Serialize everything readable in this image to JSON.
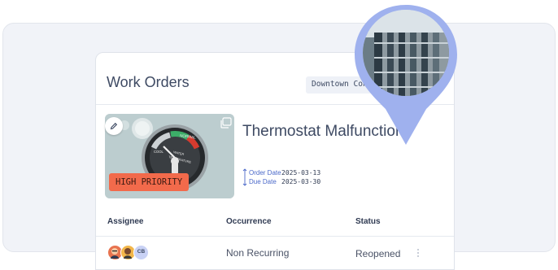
{
  "work_orders": {
    "title": "Work Orders",
    "contract_chip": "Downtown Contract",
    "item": {
      "title": "Thermostat Malfunction",
      "priority_badge": "HIGH PRIORITY",
      "order_date_label": "Order Date",
      "order_date": "2025-03-13",
      "due_date_label": "Due Date",
      "due_date": "2025-03-30"
    },
    "gauge": {
      "normal_label": "NORMAL",
      "cool_label": "COOL",
      "dial_label_line1": "WATER",
      "dial_label_line2": "TEMPERATURE"
    },
    "table": {
      "headers": [
        "Assignee",
        "Occurrence",
        "Status"
      ],
      "rows": [
        {
          "assignee_initials": "CB",
          "occurrence": "Non Recurring",
          "status": "Reopened"
        }
      ]
    }
  },
  "colors": {
    "accent_blue": "#4a68c9",
    "pin_blue": "#9fb1ee",
    "priority": "#f26a4b"
  },
  "icons": [
    "edit-icon",
    "gallery-icon",
    "location-pin-icon",
    "more-vertical-icon"
  ]
}
